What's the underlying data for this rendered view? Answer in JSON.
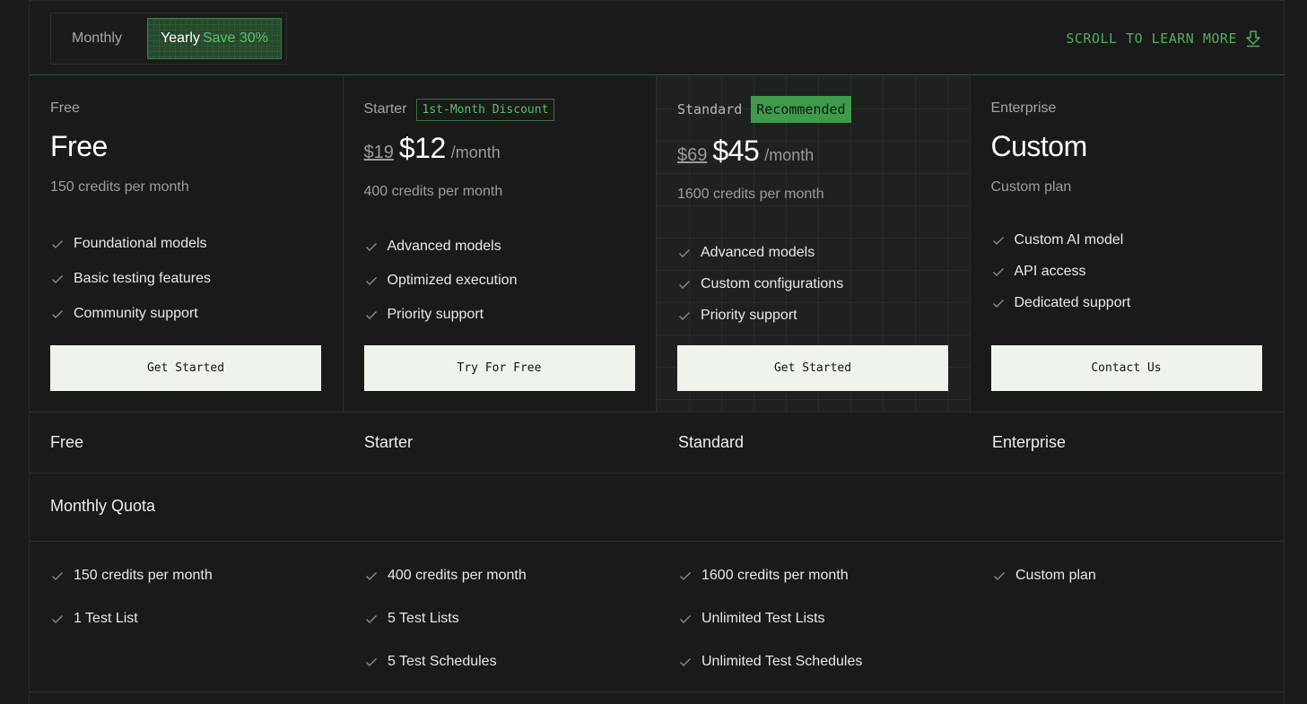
{
  "billing_toggle": {
    "monthly_label": "Monthly",
    "yearly_label": "Yearly",
    "yearly_save": "Save 30%",
    "selected": "Yearly"
  },
  "scroll_hint": {
    "label": "SCROLL TO LEARN MORE",
    "icon": "arrow-down-icon"
  },
  "plans": [
    {
      "tier": "Free",
      "price": "Free",
      "credits": "150 credits per month",
      "features": [
        "Foundational models",
        "Basic testing features",
        "Community support"
      ],
      "cta": "Get Started"
    },
    {
      "tier": "Starter",
      "badge": "1st-Month Discount",
      "old_price": "$19",
      "price": "$12",
      "per": "/month",
      "credits": "400 credits per month",
      "features": [
        "Advanced models",
        "Optimized execution",
        "Priority support"
      ],
      "cta": "Try For Free"
    },
    {
      "tier": "Standard",
      "badge": "Recommended",
      "old_price": "$69",
      "price": "$45",
      "per": "/month",
      "credits": "1600 credits per month",
      "features": [
        "Advanced models",
        "Custom configurations",
        "Priority support"
      ],
      "cta": "Get Started"
    },
    {
      "tier": "Enterprise",
      "price": "Custom",
      "credits": "Custom plan",
      "features": [
        "Custom AI model",
        "API access",
        "Dedicated support"
      ],
      "cta": "Contact Us"
    }
  ],
  "comparison": {
    "columns": [
      "Free",
      "Starter",
      "Standard",
      "Enterprise"
    ],
    "section_title": "Monthly Quota",
    "rows": [
      [
        "150 credits per month",
        "1 Test List"
      ],
      [
        "400 credits per month",
        "5 Test Lists",
        "5 Test Schedules"
      ],
      [
        "1600 credits per month",
        "Unlimited Test Lists",
        "Unlimited Test Schedules"
      ],
      [
        "Custom plan"
      ]
    ]
  },
  "colors": {
    "background": "#1a1a1a",
    "accent": "#4fae5d",
    "badge_fill": "#3f9a4b",
    "button_bg": "#eef3ec"
  }
}
